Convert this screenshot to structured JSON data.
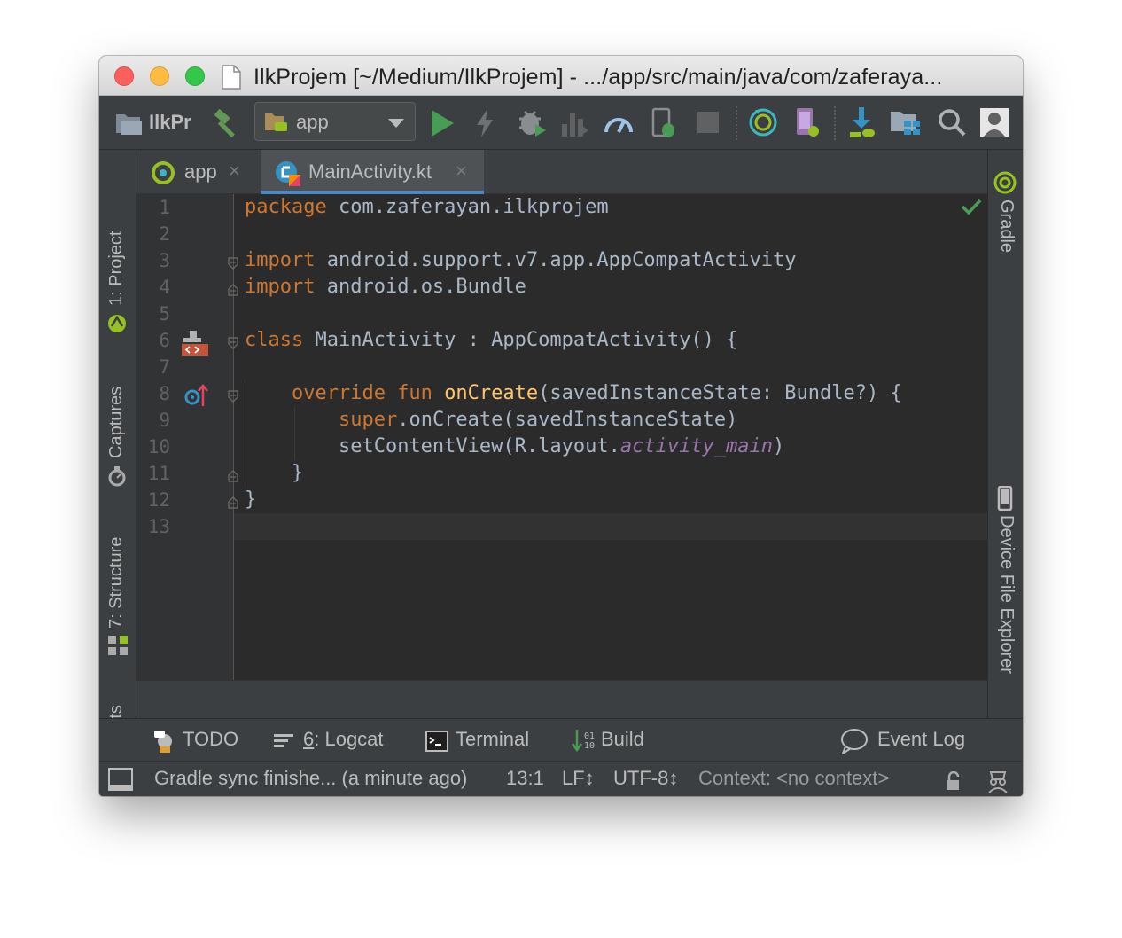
{
  "window": {
    "title": "IlkProjem [~/Medium/IlkProjem] - .../app/src/main/java/com/zaferaya..."
  },
  "toolbar": {
    "project_label": "IlkProjem",
    "run_config": "app"
  },
  "tool_windows": {
    "left": [
      "1: Project",
      "Captures",
      "7: Structure",
      "Variants"
    ],
    "right": [
      "Gradle",
      "Device File Explorer"
    ]
  },
  "tabs": [
    {
      "label": "app",
      "close": "×"
    },
    {
      "label": "MainActivity.kt",
      "close": "×"
    }
  ],
  "editor": {
    "line_numbers": [
      "1",
      "2",
      "3",
      "4",
      "5",
      "6",
      "7",
      "8",
      "9",
      "10",
      "11",
      "12",
      "13"
    ],
    "lines": [
      {
        "kw": "package",
        "rest": " com.zaferayan.ilkprojem"
      },
      {
        "kw": "import",
        "rest": " android.support.v7.app.AppCompatActivity"
      },
      {
        "kw": "import",
        "rest": " android.os.Bundle"
      },
      {
        "kw": "class",
        "rest": " MainActivity : AppCompatActivity() {"
      },
      {
        "indent": "    ",
        "kw": "override fun",
        "sp": " ",
        "fn": "onCreate",
        "rest": "(savedInstanceState: Bundle?) {"
      },
      {
        "indent": "        ",
        "kw": "super",
        "rest": ".onCreate(savedInstanceState)"
      },
      {
        "indent": "        ",
        "pre": "setContentView(R.layout.",
        "prop": "activity_main",
        "post": ")"
      },
      {
        "text": "    }"
      },
      {
        "text": "}"
      }
    ]
  },
  "bottom_tools": {
    "todo": "TODO",
    "logcat_num": "6",
    "logcat_rest": ": Logcat",
    "terminal": "Terminal",
    "build": "Build",
    "event_log": "Event Log"
  },
  "status": {
    "message": "Gradle sync finishe... (a minute ago)",
    "position": "13:1",
    "line_sep": "LF↕",
    "encoding": "UTF-8↕",
    "context": "Context: <no context>"
  },
  "colors": {
    "keyword": "#cc7832",
    "function": "#ffc66d",
    "property": "#9876aa",
    "text": "#a9b7c6",
    "editor_bg": "#2b2b2b",
    "panel_bg": "#3c3f41",
    "tab_underline": "#4a88c7",
    "run_green": "#499c54"
  }
}
